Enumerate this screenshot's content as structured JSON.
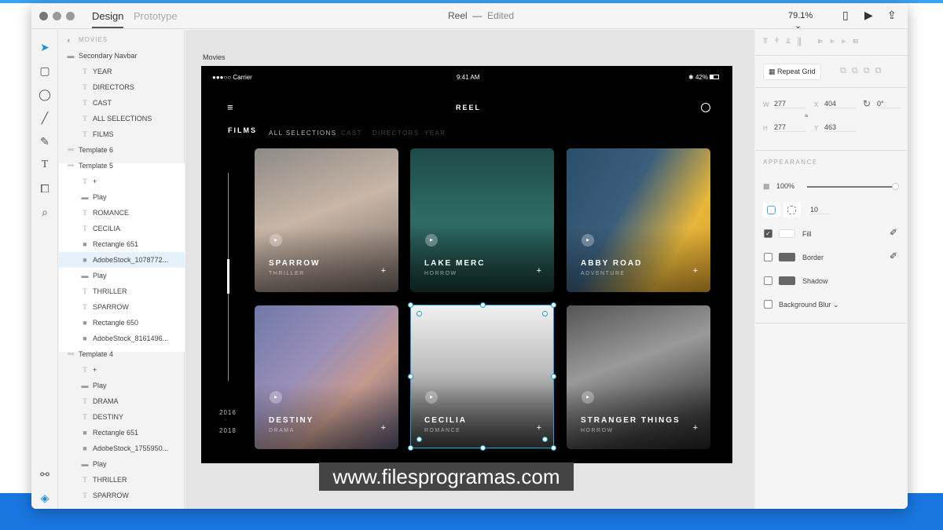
{
  "window": {
    "tabs": [
      "Design",
      "Prototype"
    ],
    "doc_title": "Reel",
    "doc_status": "Edited",
    "zoom": "79.1%"
  },
  "layers": {
    "back_label": "MOVIES",
    "items": [
      {
        "label": "Secondary Navbar",
        "icon": "folder",
        "level": 0
      },
      {
        "label": "YEAR",
        "icon": "text",
        "level": 1
      },
      {
        "label": "DIRECTORS",
        "icon": "text",
        "level": 1
      },
      {
        "label": "CAST",
        "icon": "text",
        "level": 1
      },
      {
        "label": "ALL SELECTIONS",
        "icon": "text",
        "level": 1
      },
      {
        "label": "FILMS",
        "icon": "text",
        "level": 1
      },
      {
        "label": "Template 6",
        "icon": "symbol",
        "level": 0
      },
      {
        "label": "Template 5",
        "icon": "symbol",
        "level": 0
      },
      {
        "label": "+",
        "icon": "text",
        "level": 1
      },
      {
        "label": "Play",
        "icon": "folder",
        "level": 1
      },
      {
        "label": "ROMANCE",
        "icon": "text",
        "level": 1
      },
      {
        "label": "CECILIA",
        "icon": "text",
        "level": 1
      },
      {
        "label": "Rectangle 651",
        "icon": "rect",
        "level": 1
      },
      {
        "label": "AdobeStock_1078772...",
        "icon": "rect",
        "level": 1,
        "selected": true
      },
      {
        "label": "Play",
        "icon": "folder",
        "level": 1
      },
      {
        "label": "THRILLER",
        "icon": "text",
        "level": 1
      },
      {
        "label": "SPARROW",
        "icon": "text",
        "level": 1
      },
      {
        "label": "Rectangle 650",
        "icon": "rect",
        "level": 1
      },
      {
        "label": "AdobeStock_8161496...",
        "icon": "rect",
        "level": 1
      },
      {
        "label": "Template 4",
        "icon": "symbol",
        "level": 0
      },
      {
        "label": "+",
        "icon": "text",
        "level": 1
      },
      {
        "label": "Play",
        "icon": "folder",
        "level": 1
      },
      {
        "label": "DRAMA",
        "icon": "text",
        "level": 1
      },
      {
        "label": "DESTINY",
        "icon": "text",
        "level": 1
      },
      {
        "label": "Rectangle 651",
        "icon": "rect",
        "level": 1
      },
      {
        "label": "AdobeStock_1755950...",
        "icon": "rect",
        "level": 1
      },
      {
        "label": "Play",
        "icon": "folder",
        "level": 1
      },
      {
        "label": "THRILLER",
        "icon": "text",
        "level": 1
      },
      {
        "label": "SPARROW",
        "icon": "text",
        "level": 1
      }
    ]
  },
  "artboard": {
    "name": "Movies",
    "status": {
      "carrier": "●●●○○ Carrier",
      "time": "9:41 AM",
      "battery": "42%"
    },
    "app_title": "REEL",
    "nav": [
      "FILMS",
      "ALL SELECTIONS",
      "CAST",
      "DIRECTORS",
      "YEAR"
    ],
    "years": [
      "2016",
      "-",
      "2018"
    ],
    "cards": [
      {
        "title": "SPARROW",
        "genre": "THRILLER",
        "bg": "linear-gradient(160deg,#8d8a86,#c9b6a7 45%,#6e625b)"
      },
      {
        "title": "LAKE MERC",
        "genre": "HORROW",
        "bg": "linear-gradient(180deg,#1f4a48,#2f6c66 50%,#173734)"
      },
      {
        "title": "ABBY ROAD",
        "genre": "ADVENTURE",
        "bg": "linear-gradient(120deg,#2a4f6a,#3b5e7c 40%,#e8b63a 75%,#d49a2a)"
      },
      {
        "title": "DESTINY",
        "genre": "DRAMA",
        "bg": "linear-gradient(135deg,#6f79a8,#9a8fb8 40%,#c59a8e 65%,#55506b)"
      },
      {
        "title": "CECILIA",
        "genre": "ROMANCE",
        "bg": "linear-gradient(180deg,#f1f1f1,#bdbdbd 45%,#3a3a3a)"
      },
      {
        "title": "STRANGER THINGS",
        "genre": "HORROW",
        "bg": "linear-gradient(160deg,#555,#9a9a9a 40%,#3c3c3c 80%,#222)"
      }
    ]
  },
  "properties": {
    "repeat_grid": "Repeat Grid",
    "w": "277",
    "h": "277",
    "x": "404",
    "y": "463",
    "rotation": "0°",
    "appearance": "APPEARANCE",
    "opacity": 0.99,
    "opacity_label": "100%",
    "radius": "10",
    "fill": {
      "label": "Fill",
      "checked": true,
      "color": "#ffffff"
    },
    "border": {
      "label": "Border",
      "checked": false,
      "color": "#666666"
    },
    "shadow": {
      "label": "Shadow",
      "checked": false,
      "color": "#666666"
    },
    "blur": {
      "label": "Background Blur",
      "checked": false
    }
  },
  "watermark": "www.filesprogramas.com"
}
